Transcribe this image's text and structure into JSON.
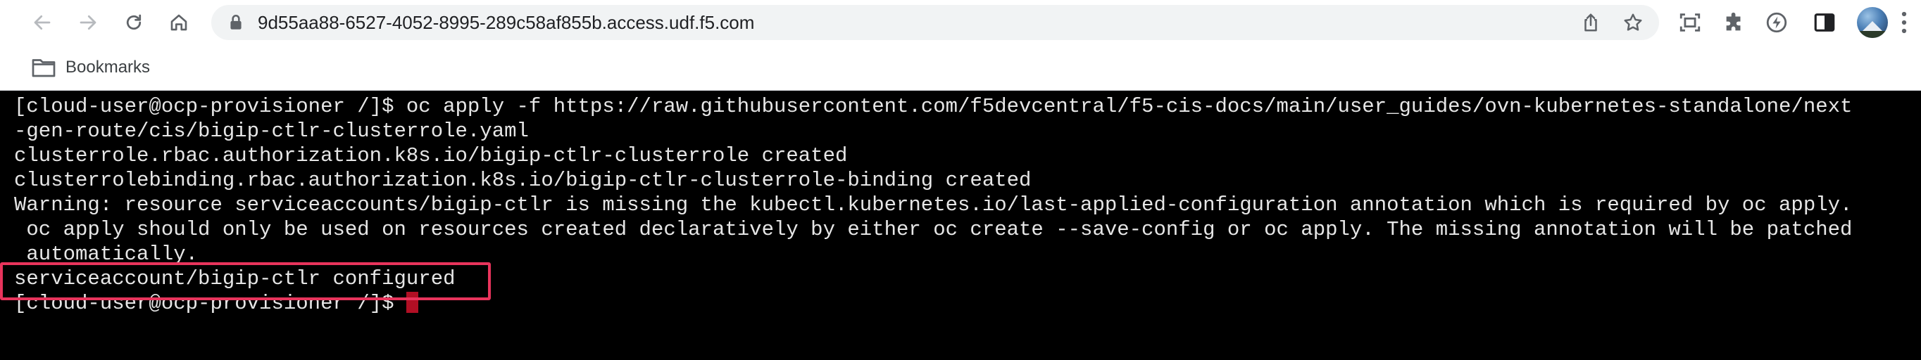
{
  "browser": {
    "address_bar": {
      "url": "9d55aa88-6527-4052-8995-289c58af855b.access.udf.f5.com"
    },
    "bookmarks_bar": {
      "folder_label": "Bookmarks"
    },
    "icons": {
      "back": "arrow-left-icon",
      "forward": "arrow-right-icon",
      "reload": "reload-icon",
      "home": "home-icon",
      "lock": "lock-icon",
      "share": "share-icon",
      "bookmark_star": "star-icon",
      "screenshot": "screen-capture-icon",
      "extensions": "puzzle-piece-icon",
      "performance": "lightning-icon",
      "side_panel": "side-panel-icon",
      "profile": "avatar",
      "menu": "kebab-menu-icon"
    }
  },
  "terminal": {
    "lines": [
      "[cloud-user@ocp-provisioner /]$ oc apply -f https://raw.githubusercontent.com/f5devcentral/f5-cis-docs/main/user_guides/ovn-kubernetes-standalone/next",
      "-gen-route/cis/bigip-ctlr-clusterrole.yaml",
      "clusterrole.rbac.authorization.k8s.io/bigip-ctlr-clusterrole created",
      "clusterrolebinding.rbac.authorization.k8s.io/bigip-ctlr-clusterrole-binding created",
      "Warning: resource serviceaccounts/bigip-ctlr is missing the kubectl.kubernetes.io/last-applied-configuration annotation which is required by oc apply.",
      " oc apply should only be used on resources created declaratively by either oc create --save-config or oc apply. The missing annotation will be patched",
      " automatically.",
      "serviceaccount/bigip-ctlr configured",
      "[cloud-user@ocp-provisioner /]$ "
    ],
    "highlighted_line": "serviceaccount/bigip-ctlr configured",
    "colors": {
      "background": "#000000",
      "text": "#e6e6e6",
      "cursor": "#b10f24",
      "highlight_box": "#e8345c"
    }
  }
}
